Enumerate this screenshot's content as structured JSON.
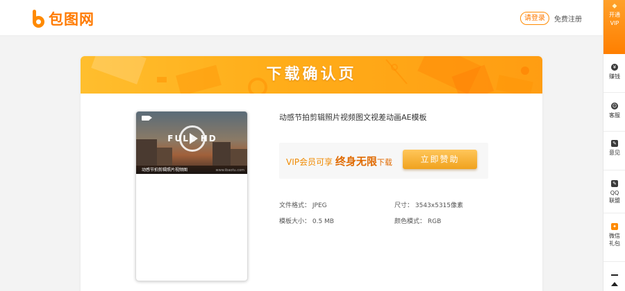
{
  "header": {
    "logo_text": "包图网",
    "login_label": "请登录",
    "register_label": "免费注册"
  },
  "rail": {
    "vip_line1": "开通",
    "vip_line2": "VIP",
    "items": [
      {
        "label": "赚钱",
        "icon": "money-icon"
      },
      {
        "label": "客服",
        "icon": "support-icon"
      },
      {
        "label": "意见",
        "icon": "feedback-icon"
      },
      {
        "label": "QQ联盟",
        "label1": "QQ",
        "label2": "联盟",
        "icon": "qq-icon"
      },
      {
        "label": "微信礼包",
        "label1": "微信",
        "label2": "礼包",
        "icon": "gift-icon"
      }
    ]
  },
  "banner": {
    "title": "下载确认页"
  },
  "preview": {
    "overlay_text": "FULL HD",
    "caption": "动感节拍剪辑照片视频图",
    "watermark": "www.ibaotu.com"
  },
  "product": {
    "title": "动感节拍剪辑照片视频图文视差动画AE模板",
    "vip_prefix": "VIP会员可享",
    "vip_highlight": "终身无限",
    "vip_suffix": "下载",
    "sponsor_label": "立即赞助",
    "file_format": "文件格式： JPEG",
    "size": "尺寸： 3543x5315像素",
    "template_size": "模板大小： 0.5 MB",
    "color_mode": "颜色模式： RGB"
  },
  "colors": {
    "accent": "#ff8a00",
    "banner": "#ffae1a",
    "button": "#f0a21e"
  }
}
